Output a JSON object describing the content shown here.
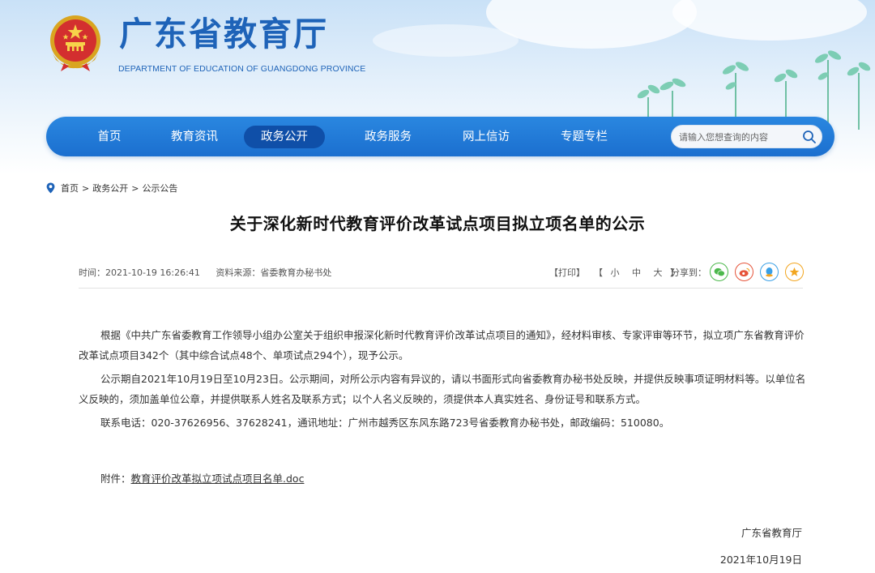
{
  "header": {
    "site_title": "广东省教育厅",
    "site_subtitle": "DEPARTMENT OF EDUCATION OF GUANGDONG PROVINCE",
    "emblem_icon": "national-emblem-icon"
  },
  "nav": {
    "items": [
      {
        "label": "首页",
        "active": false
      },
      {
        "label": "教育资讯",
        "active": false
      },
      {
        "label": "政务公开",
        "active": true
      },
      {
        "label": "政务服务",
        "active": false
      },
      {
        "label": "网上信访",
        "active": false
      },
      {
        "label": "专题专栏",
        "active": false
      }
    ],
    "search": {
      "placeholder": "请输入您想查询的内容",
      "value": ""
    }
  },
  "breadcrumb": {
    "items": [
      "首页",
      "政务公开",
      "公示公告"
    ],
    "separator": ">"
  },
  "article": {
    "title": "关于深化新时代教育评价改革试点项目拟立项名单的公示",
    "meta": {
      "time": "时间：2021-10-19 16:26:41",
      "source": "资料来源：省委教育办秘书处",
      "print": "【打印】",
      "font_size": {
        "open": "【",
        "small": "小",
        "medium": "中",
        "large": "大",
        "close": "】"
      },
      "share_label": "分享到："
    },
    "share_icons": [
      {
        "name": "wechat-icon",
        "color": "#4cb84c"
      },
      {
        "name": "weibo-icon",
        "color": "#e6543a"
      },
      {
        "name": "qq-icon",
        "color": "#3aa0e6"
      },
      {
        "name": "favorite-icon",
        "color": "#f2a51f"
      }
    ],
    "paragraphs": [
      "根据《中共广东省委教育工作领导小组办公室关于组织申报深化新时代教育评价改革试点项目的通知》，经材料审核、专家评审等环节，拟立项广东省教育评价改革试点项目342个（其中综合试点48个、单项试点294个），现予公示。",
      "公示期自2021年10月19日至10月23日。公示期间，对所公示内容有异议的，请以书面形式向省委教育办秘书处反映，并提供反映事项证明材料等。以单位名义反映的，须加盖单位公章，并提供联系人姓名及联系方式；以个人名义反映的，须提供本人真实姓名、身份证号和联系方式。",
      "联系电话：020-37626956、37628241，通讯地址：广州市越秀区东风东路723号省委教育办秘书处，邮政编码：510080。"
    ],
    "attachment": {
      "label": "附件：",
      "link_text": "教育评价改革拟立项试点项目名单.doc"
    },
    "signature": {
      "org": "广东省教育厅",
      "date": "2021年10月19日"
    }
  },
  "colors": {
    "brand_blue": "#1e63b8",
    "nav_bg": "#1b6fcf",
    "nav_active": "#0f4fa8"
  }
}
